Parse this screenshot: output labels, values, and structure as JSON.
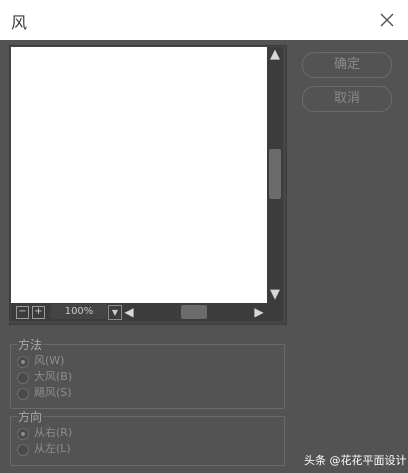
{
  "window": {
    "title": "风"
  },
  "buttons": {
    "ok": "确定",
    "cancel": "取消"
  },
  "preview": {
    "zoom_value": "100%",
    "zoom_out_symbol": "−",
    "zoom_in_symbol": "+"
  },
  "method_group": {
    "title": "方法",
    "options": [
      {
        "label": "风(W)",
        "selected": true
      },
      {
        "label": "大风(B)",
        "selected": false
      },
      {
        "label": "飓风(S)",
        "selected": false
      }
    ]
  },
  "direction_group": {
    "title": "方向",
    "options": [
      {
        "label": "从右(R)",
        "selected": true
      },
      {
        "label": "从左(L)",
        "selected": false
      }
    ]
  },
  "watermark": "头条 @花花平面设计",
  "colors": {
    "dialog_bg": "#535353",
    "title_bg": "#ffffff",
    "canvas": "#ffffff"
  },
  "icons": [
    "close-icon",
    "scroll-up-icon",
    "scroll-down-icon",
    "scroll-left-icon",
    "scroll-right-icon",
    "chevron-down-icon"
  ]
}
